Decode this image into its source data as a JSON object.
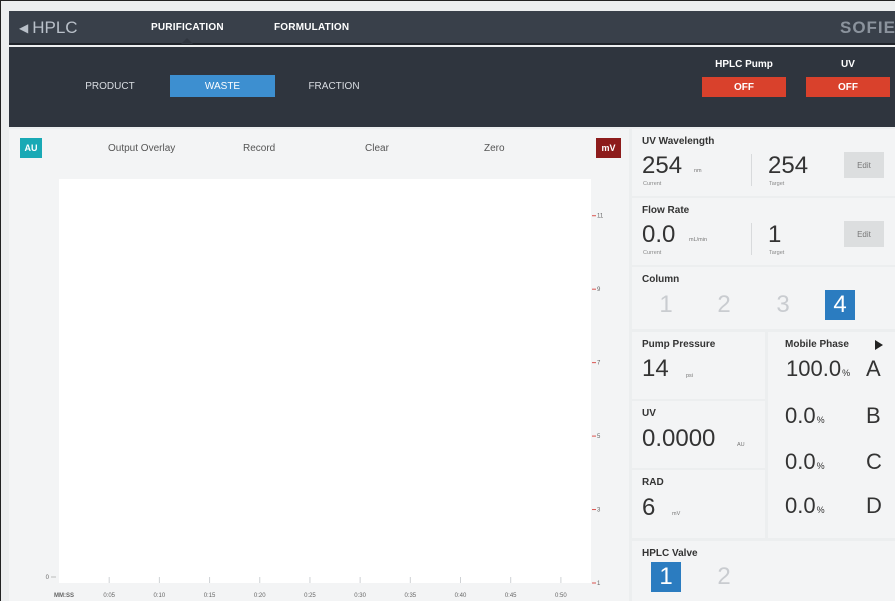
{
  "header": {
    "back_label": "HPLC",
    "tabs": [
      {
        "label": "PURIFICATION",
        "active": true
      },
      {
        "label": "FORMULATION",
        "active": false
      }
    ],
    "brand": "SOFIE"
  },
  "destinations": {
    "items": [
      {
        "label": "PRODUCT",
        "active": false
      },
      {
        "label": "WASTE",
        "active": true
      },
      {
        "label": "FRACTION",
        "active": false
      }
    ]
  },
  "devices": {
    "hplc_pump": {
      "label": "HPLC Pump",
      "state": "OFF"
    },
    "uv": {
      "label": "UV",
      "state": "OFF"
    }
  },
  "chart": {
    "au_badge": "AU",
    "mv_badge": "mV",
    "toolbar": [
      "Output Overlay",
      "Record",
      "Clear",
      "Zero"
    ],
    "time_axis_label": "MM:SS"
  },
  "chart_data": {
    "type": "line",
    "xlabel": "MM:SS",
    "ylabel_left": "AU",
    "ylabel_right": "mV",
    "x_ticks": [
      "0:05",
      "0:10",
      "0:15",
      "0:20",
      "0:25",
      "0:30",
      "0:35",
      "0:40",
      "0:45",
      "0:50"
    ],
    "x_range": [
      "0:00",
      "0:53"
    ],
    "y_left_ticks": [
      "0"
    ],
    "y_right_ticks": [
      "1",
      "3",
      "5",
      "7",
      "9",
      "11"
    ],
    "y_right_range": [
      1,
      12
    ],
    "series": []
  },
  "uv_wavelength": {
    "title": "UV Wavelength",
    "current_value": "254",
    "current_unit": "nm",
    "current_label": "Current",
    "target_value": "254",
    "target_label": "Target",
    "edit_label": "Edit"
  },
  "flow_rate": {
    "title": "Flow Rate",
    "current_value": "0.0",
    "current_unit": "mL/min",
    "current_label": "Current",
    "target_value": "1",
    "target_label": "Target",
    "edit_label": "Edit"
  },
  "column": {
    "title": "Column",
    "options": [
      "1",
      "2",
      "3",
      "4"
    ],
    "selected": "4"
  },
  "pump_pressure": {
    "title": "Pump Pressure",
    "value": "14",
    "unit": "psi"
  },
  "uv_reading": {
    "title": "UV",
    "value": "0.0000",
    "unit": "AU"
  },
  "rad": {
    "title": "RAD",
    "value": "6",
    "unit": "mV"
  },
  "mobile_phase": {
    "title": "Mobile Phase",
    "icon": "play-icon",
    "rows": [
      {
        "value": "100.0",
        "unit": "%",
        "letter": "A"
      },
      {
        "value": "0.0",
        "unit": "%",
        "letter": "B"
      },
      {
        "value": "0.0",
        "unit": "%",
        "letter": "C"
      },
      {
        "value": "0.0",
        "unit": "%",
        "letter": "D"
      }
    ]
  },
  "hplc_valve": {
    "title": "HPLC Valve",
    "options": [
      "1",
      "2"
    ],
    "selected": "1"
  },
  "colors": {
    "header_bg": "#39404a",
    "subbar_bg": "#2f353e",
    "active_blue": "#3d8fd0",
    "selected_blue": "#2b7cc0",
    "off_red": "#d9412c",
    "au_teal": "#19a9b5",
    "mv_maroon": "#8d1c1c"
  }
}
